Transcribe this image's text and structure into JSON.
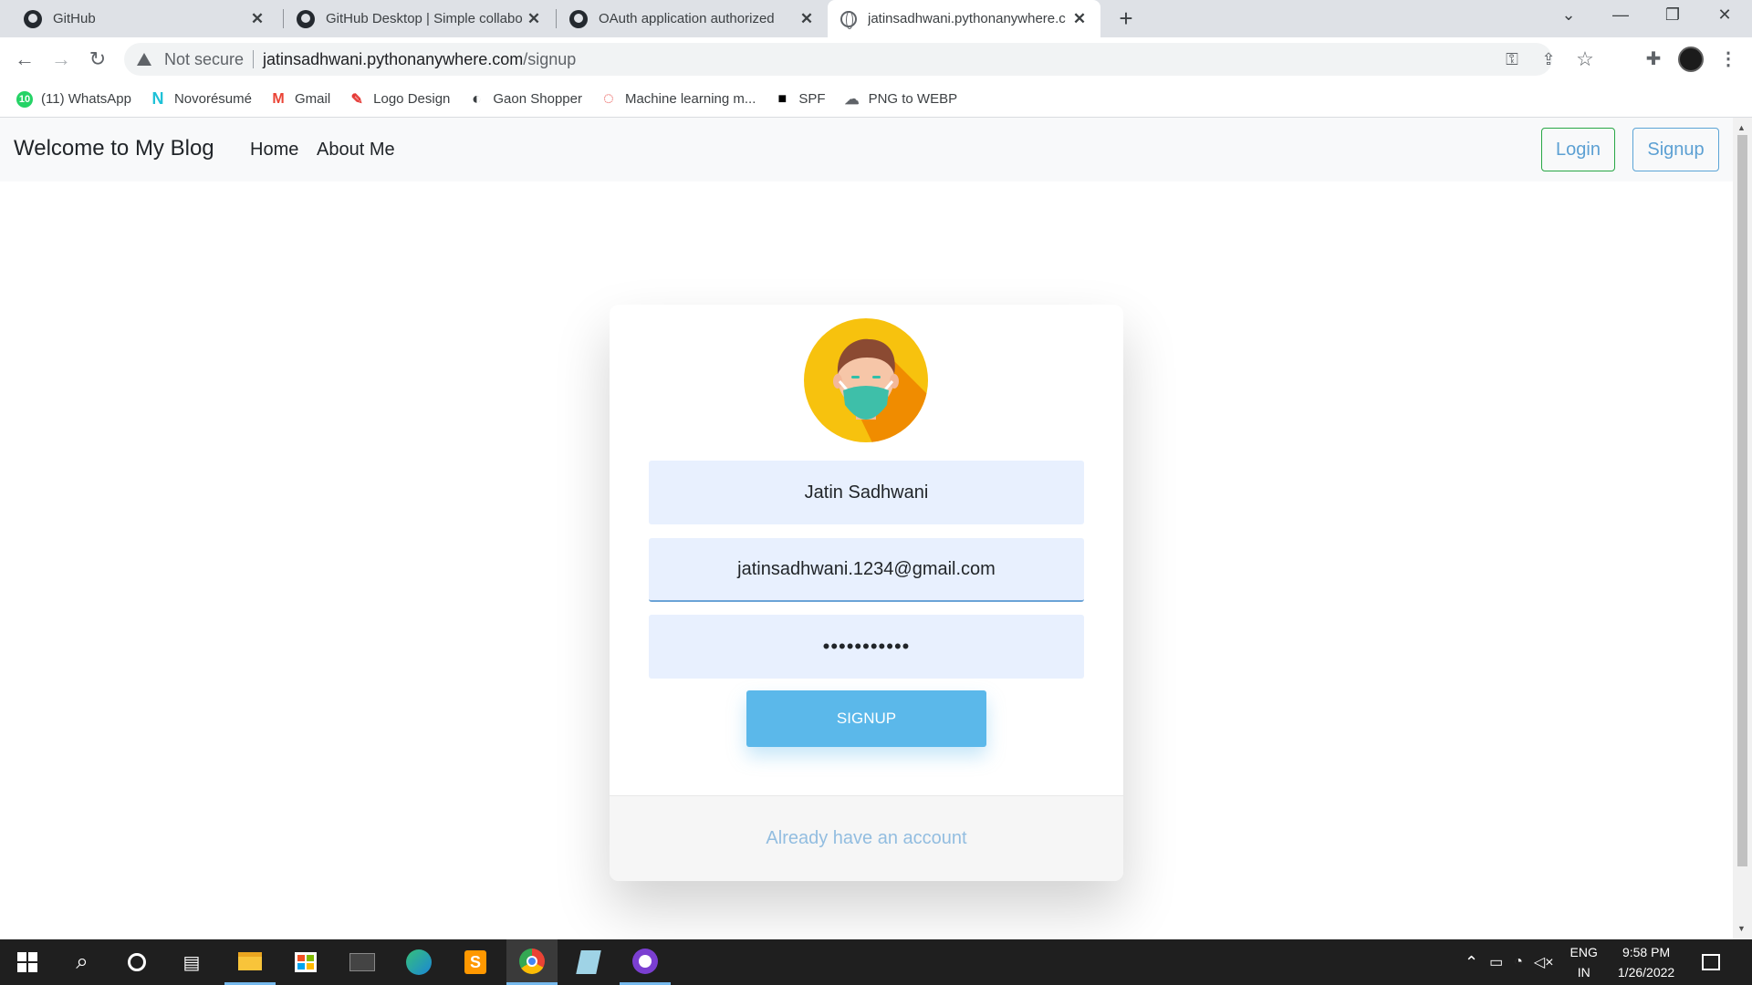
{
  "browser": {
    "tabs": [
      {
        "title": "GitHub",
        "icon": "github-icon",
        "active": false
      },
      {
        "title": "GitHub Desktop | Simple collabo",
        "icon": "github-icon",
        "active": false
      },
      {
        "title": "OAuth application authorized",
        "icon": "github-icon",
        "active": false
      },
      {
        "title": "jatinsadhwani.pythonanywhere.c",
        "icon": "globe-icon",
        "active": true
      }
    ],
    "close_glyph": "✕",
    "new_tab_glyph": "+",
    "window_controls": [
      "⌄",
      "—",
      "❐",
      "✕"
    ],
    "security_label": "Not secure",
    "url_host": "jatinsadhwani.pythonanywhere.com",
    "url_path": "/signup"
  },
  "bookmarks": [
    {
      "label": "(11) WhatsApp",
      "icon": "whatsapp-icon",
      "color": "#25d366",
      "glyph": "10"
    },
    {
      "label": "Novorésumé",
      "icon": "novoresume-icon",
      "color": "#1ec1d7",
      "glyph": "N"
    },
    {
      "label": "Gmail",
      "icon": "gmail-icon",
      "color": "#ea4335",
      "glyph": "M"
    },
    {
      "label": "Logo Design",
      "icon": "logo-design-icon",
      "color": "#e53935",
      "glyph": "✎"
    },
    {
      "label": "Gaon Shopper",
      "icon": "globe-icon",
      "color": "#3c4043",
      "glyph": "◐"
    },
    {
      "label": "Machine learning m...",
      "icon": "ml-icon",
      "color": "#e53935",
      "glyph": "◌"
    },
    {
      "label": "SPF",
      "icon": "spf-icon",
      "color": "#000000",
      "glyph": "■"
    },
    {
      "label": "PNG to WEBP",
      "icon": "cloud-icon",
      "color": "#5f6368",
      "glyph": "☁"
    }
  ],
  "site": {
    "brand": "Welcome to My Blog",
    "nav_links": [
      "Home",
      "About Me"
    ],
    "login_label": "Login",
    "signup_label": "Signup"
  },
  "form": {
    "name_value": "Jatin Sadhwani",
    "email_value": "jatinsadhwani.1234@gmail.com",
    "password_value": "•••••••••••",
    "submit_label": "SIGNUP",
    "footer_link": "Already have an account"
  },
  "taskbar": {
    "language": "ENG",
    "region": "IN",
    "time": "9:58 PM",
    "date": "1/26/2022"
  },
  "colors": {
    "accent_blue": "#5bb8ea",
    "link_blue": "#5ca0d3",
    "login_border": "#28a745",
    "input_bg": "#e8f0fe"
  }
}
